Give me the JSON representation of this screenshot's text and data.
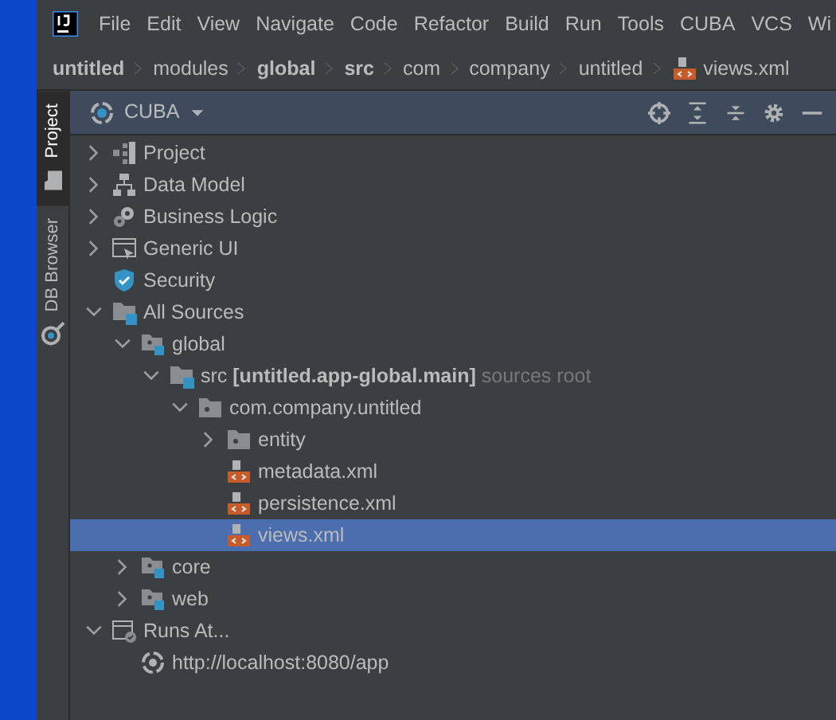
{
  "menu": [
    "File",
    "Edit",
    "View",
    "Navigate",
    "Code",
    "Refactor",
    "Build",
    "Run",
    "Tools",
    "CUBA",
    "VCS",
    "Wi"
  ],
  "breadcrumb": [
    {
      "label": "untitled",
      "bold": true,
      "kind": "plain"
    },
    {
      "label": "modules",
      "bold": false,
      "kind": "plain"
    },
    {
      "label": "global",
      "bold": true,
      "kind": "plain"
    },
    {
      "label": "src",
      "bold": true,
      "kind": "plain"
    },
    {
      "label": "com",
      "bold": false,
      "kind": "plain"
    },
    {
      "label": "company",
      "bold": false,
      "kind": "plain"
    },
    {
      "label": "untitled",
      "bold": false,
      "kind": "plain"
    },
    {
      "label": "views.xml",
      "bold": false,
      "kind": "xml"
    }
  ],
  "side_tabs": [
    {
      "label": "Project",
      "selected": true,
      "kind": "folder"
    },
    {
      "label": "DB Browser",
      "selected": false,
      "kind": "db"
    }
  ],
  "panel": {
    "title": "CUBA"
  },
  "tree": [
    {
      "label": "Project",
      "kind": "project",
      "expanded": false,
      "selected": false
    },
    {
      "label": "Data Model",
      "kind": "model",
      "expanded": false,
      "selected": false
    },
    {
      "label": "Business Logic",
      "kind": "gears",
      "expanded": false,
      "selected": false
    },
    {
      "label": "Generic UI",
      "kind": "ui",
      "expanded": false,
      "selected": false
    },
    {
      "label": "Security",
      "kind": "shield",
      "selected": false
    },
    {
      "label": "All Sources",
      "kind": "sources",
      "expanded": true,
      "selected": false,
      "children": [
        {
          "label": "global",
          "kind": "module",
          "expanded": true,
          "selected": false,
          "children": [
            {
              "label": "src",
              "module": "[untitled.app-global.main]",
              "hint": "sources root",
              "kind": "srcfolder",
              "expanded": true,
              "selected": false,
              "children": [
                {
                  "label": "com.company.untitled",
                  "kind": "package",
                  "expanded": true,
                  "selected": false,
                  "children": [
                    {
                      "label": "entity",
                      "kind": "package",
                      "expanded": false,
                      "selected": false
                    },
                    {
                      "label": "metadata.xml",
                      "kind": "xml",
                      "selected": false
                    },
                    {
                      "label": "persistence.xml",
                      "kind": "xml",
                      "selected": false
                    },
                    {
                      "label": "views.xml",
                      "kind": "xml",
                      "selected": true
                    }
                  ]
                }
              ]
            }
          ]
        },
        {
          "label": "core",
          "kind": "module",
          "expanded": false,
          "selected": false
        },
        {
          "label": "web",
          "kind": "module",
          "expanded": false,
          "selected": false
        }
      ]
    },
    {
      "label": "Runs At...",
      "kind": "runs",
      "expanded": true,
      "selected": false,
      "children": [
        {
          "label": "http://localhost:8080/app",
          "kind": "url",
          "selected": false
        }
      ]
    }
  ]
}
